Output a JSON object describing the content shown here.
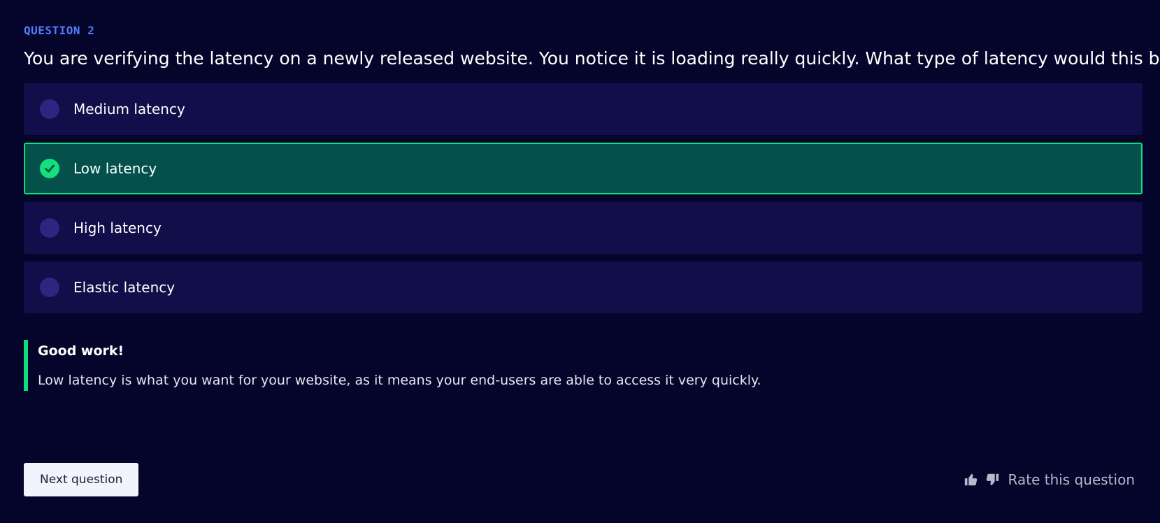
{
  "question": {
    "number_label": "QUESTION 2",
    "text": "You are verifying the latency on a newly released website. You notice it is loading really quickly. What type of latency would this be?"
  },
  "options": [
    {
      "label": "Medium latency",
      "state": "default"
    },
    {
      "label": "Low latency",
      "state": "correct"
    },
    {
      "label": "High latency",
      "state": "default"
    },
    {
      "label": "Elastic latency",
      "state": "default"
    }
  ],
  "feedback": {
    "title": "Good work!",
    "text": "Low latency is what you want for your website, as it means your end-users are able to access it very quickly."
  },
  "footer": {
    "next_label": "Next question",
    "rate_label": "Rate this question",
    "icons": [
      "thumbs-up-icon",
      "thumbs-down-icon"
    ]
  },
  "colors": {
    "background": "#05042a",
    "option_bg": "#110e4a",
    "correct_bg": "#03514a",
    "correct_accent": "#0fdc7b",
    "question_label": "#4f7cff"
  }
}
